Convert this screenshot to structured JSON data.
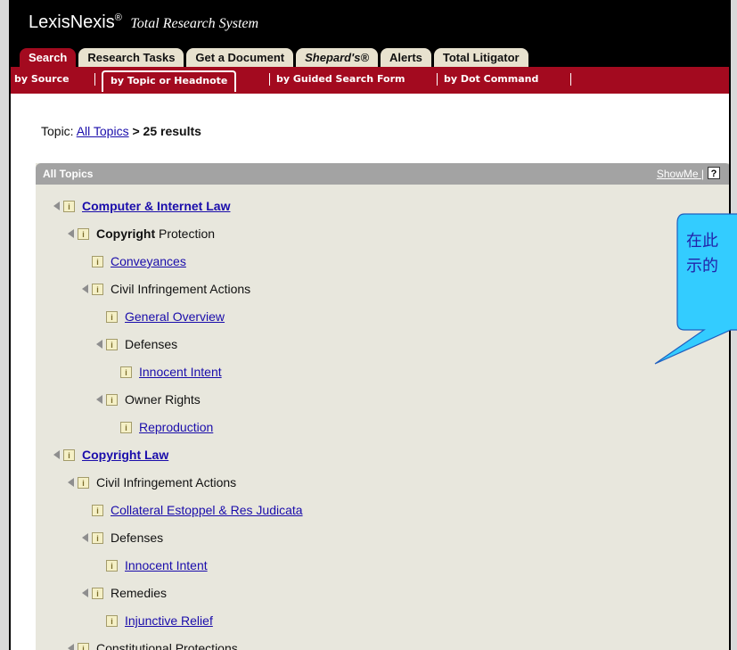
{
  "header": {
    "logo_brand": "LexisNexis",
    "logo_mark": "®",
    "logo_sub": "Total Research System"
  },
  "tabs": [
    {
      "label": "Search",
      "active": true
    },
    {
      "label": "Research Tasks"
    },
    {
      "label": "Get a Document"
    },
    {
      "label": "Shepard's®",
      "italic": true
    },
    {
      "label": "Alerts"
    },
    {
      "label": "Total Litigator"
    }
  ],
  "subnav": [
    {
      "label": "by Source"
    },
    {
      "label": "by Topic or Headnote",
      "active": true
    },
    {
      "label": "by Guided Search Form"
    },
    {
      "label": "by Dot Command"
    }
  ],
  "topic_line": {
    "prefix": "Topic:",
    "link": "All Topics",
    "suffix": "> 25 results"
  },
  "panel": {
    "title": "All Topics",
    "showme": "ShowMe",
    "separator": "|",
    "help_icon_glyph": "?"
  },
  "tree": [
    {
      "label": "Computer & Internet Law",
      "level": 0,
      "type": "bold-link",
      "expand": true
    },
    {
      "label_bold": "Copyright",
      "label": " Protection",
      "level": 1,
      "type": "text",
      "expand": true
    },
    {
      "label": "Conveyances",
      "level": 2,
      "type": "link",
      "expand": false
    },
    {
      "label": "Civil Infringement Actions",
      "level": 2,
      "type": "text",
      "expand": true
    },
    {
      "label": "General Overview",
      "level": 3,
      "type": "link",
      "expand": false
    },
    {
      "label": "Defenses",
      "level": 3,
      "type": "text",
      "expand": true
    },
    {
      "label": "Innocent Intent",
      "level": 4,
      "type": "link",
      "expand": false
    },
    {
      "label": "Owner Rights",
      "level": 3,
      "type": "text",
      "expand": true
    },
    {
      "label": "Reproduction",
      "level": 4,
      "type": "link",
      "expand": false
    },
    {
      "label": "Copyright Law",
      "level": 0,
      "type": "bold-link",
      "expand": true
    },
    {
      "label": "Civil Infringement Actions",
      "level": 1,
      "type": "text",
      "expand": true
    },
    {
      "label": "Collateral Estoppel & Res Judicata",
      "level": 2,
      "type": "link",
      "expand": false
    },
    {
      "label": "Defenses",
      "level": 2,
      "type": "text",
      "expand": true
    },
    {
      "label": "Innocent Intent",
      "level": 3,
      "type": "link",
      "expand": false
    },
    {
      "label": "Remedies",
      "level": 2,
      "type": "text",
      "expand": true
    },
    {
      "label": "Injunctive Relief",
      "level": 3,
      "type": "link",
      "expand": false
    },
    {
      "label": "Constitutional Protections",
      "level": 1,
      "type": "text",
      "expand": true
    }
  ],
  "callout": {
    "line1": "在此",
    "line2": "示的"
  },
  "colors": {
    "brand_red": "#a30a1f",
    "link_blue": "#1a0dab",
    "panel_bg": "#e8e7dd",
    "callout_fill": "#33ccff"
  }
}
